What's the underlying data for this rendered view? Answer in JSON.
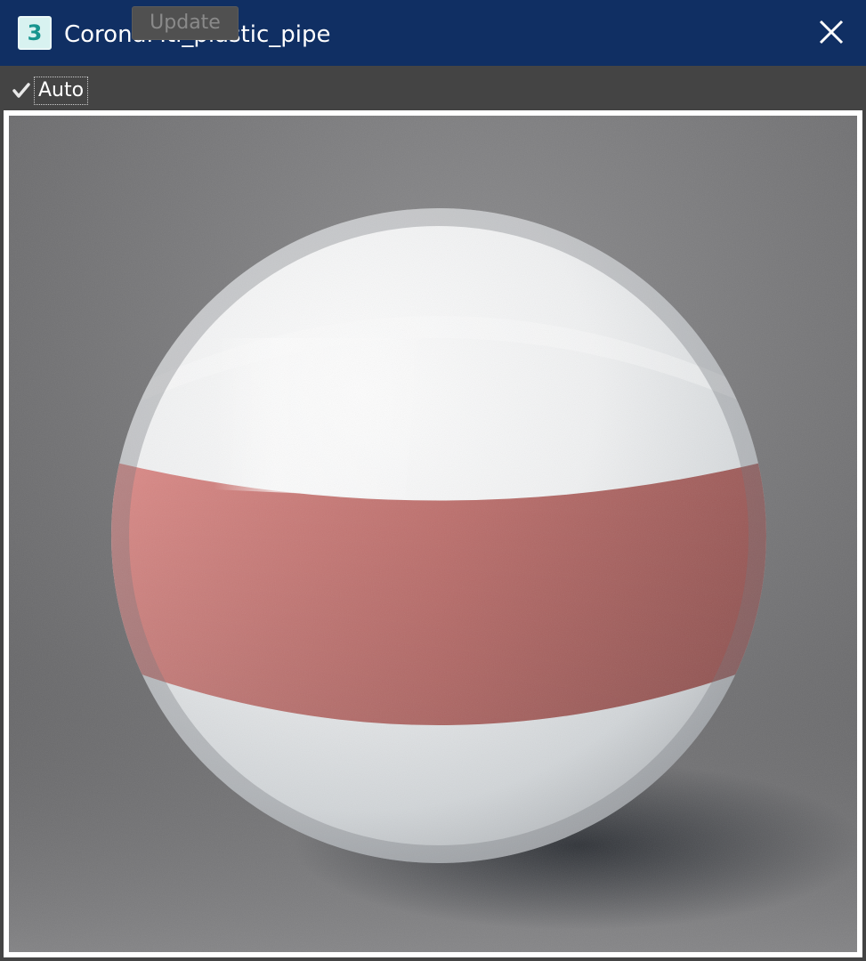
{
  "window": {
    "title": "CoronaMtl_plastic_pipe",
    "app_icon_glyph": "3",
    "close_icon": "close-icon"
  },
  "toolbar": {
    "auto_label": "Auto",
    "auto_checked": true,
    "update_label": "Update",
    "update_enabled": false
  },
  "preview": {
    "description_colors": {
      "background": "#6e6e70",
      "sphere_white": "#e9ebec",
      "stripe": "#c9726f"
    }
  },
  "colors": {
    "titlebar": "#102f63",
    "toolbar": "#444444"
  }
}
